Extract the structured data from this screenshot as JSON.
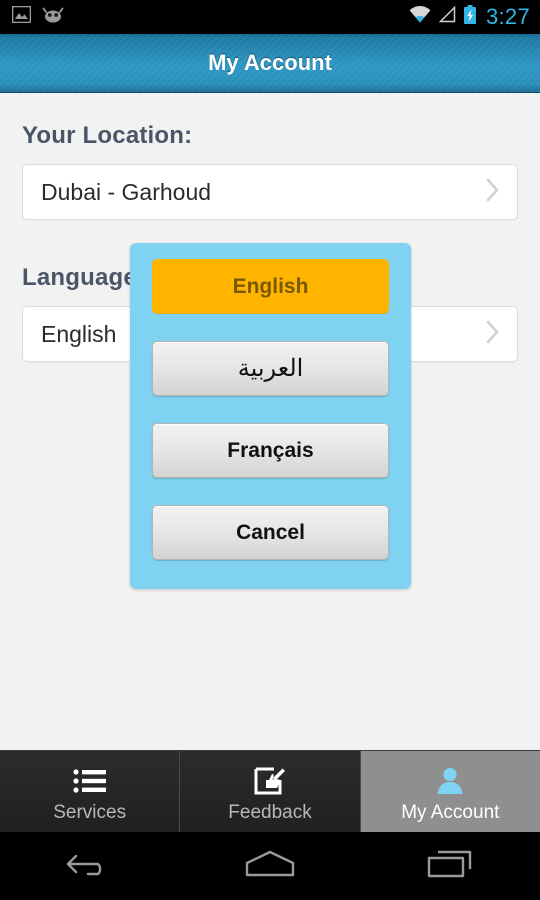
{
  "status_bar": {
    "left_icons": [
      {
        "name": "image-icon"
      },
      {
        "name": "android-head-icon"
      }
    ],
    "right_icons": [
      {
        "name": "wifi-icon"
      },
      {
        "name": "cellular-signal-icon"
      },
      {
        "name": "battery-charging-icon"
      }
    ],
    "time": "3:27",
    "time_color": "#33b5e5"
  },
  "title_bar": {
    "title": "My Account",
    "background_color": "#2e97c4"
  },
  "content": {
    "location": {
      "label": "Your Location:",
      "value": "Dubai - Garhoud",
      "chevron": "chevron-right-icon"
    },
    "language": {
      "label": "Language:",
      "value": "English",
      "chevron": "chevron-right-icon"
    }
  },
  "dialog": {
    "background_color": "#7fd3f0",
    "selected_color": "#ffb400",
    "buttons": [
      {
        "label": "English",
        "selected": true
      },
      {
        "label": "العربية",
        "selected": false
      },
      {
        "label": "Français",
        "selected": false
      },
      {
        "label": "Cancel",
        "selected": false
      }
    ]
  },
  "tab_bar": {
    "tabs": [
      {
        "label": "Services",
        "icon": "list-icon",
        "active": false
      },
      {
        "label": "Feedback",
        "icon": "compose-feedback-icon",
        "active": false
      },
      {
        "label": "My Account",
        "icon": "person-icon",
        "active": true
      }
    ],
    "active_background": "#8f8f8f",
    "active_icon_color": "#7fd4f5"
  },
  "nav_bar": {
    "buttons": [
      {
        "name": "back-button",
        "icon": "back-arrow-icon"
      },
      {
        "name": "home-button",
        "icon": "home-icon"
      },
      {
        "name": "recents-button",
        "icon": "recents-icon"
      }
    ]
  }
}
